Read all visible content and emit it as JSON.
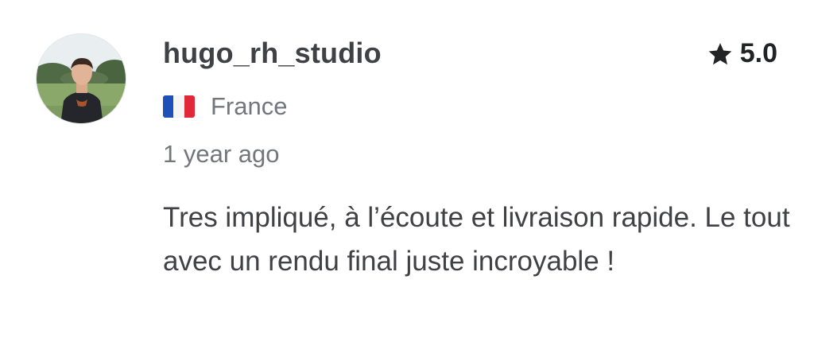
{
  "reviewer": {
    "username": "hugo_rh_studio",
    "country": "France",
    "flag_icon": "flag-france-icon",
    "timestamp": "1 year ago"
  },
  "rating": {
    "value": "5.0",
    "icon": "star-icon"
  },
  "review": {
    "text": "Tres impliqué, à l’écoute et livraison rapide. Le tout avec un rendu final juste incroyable !"
  },
  "colors": {
    "text_primary": "#404145",
    "text_secondary": "#74767e",
    "star": "#222325"
  }
}
